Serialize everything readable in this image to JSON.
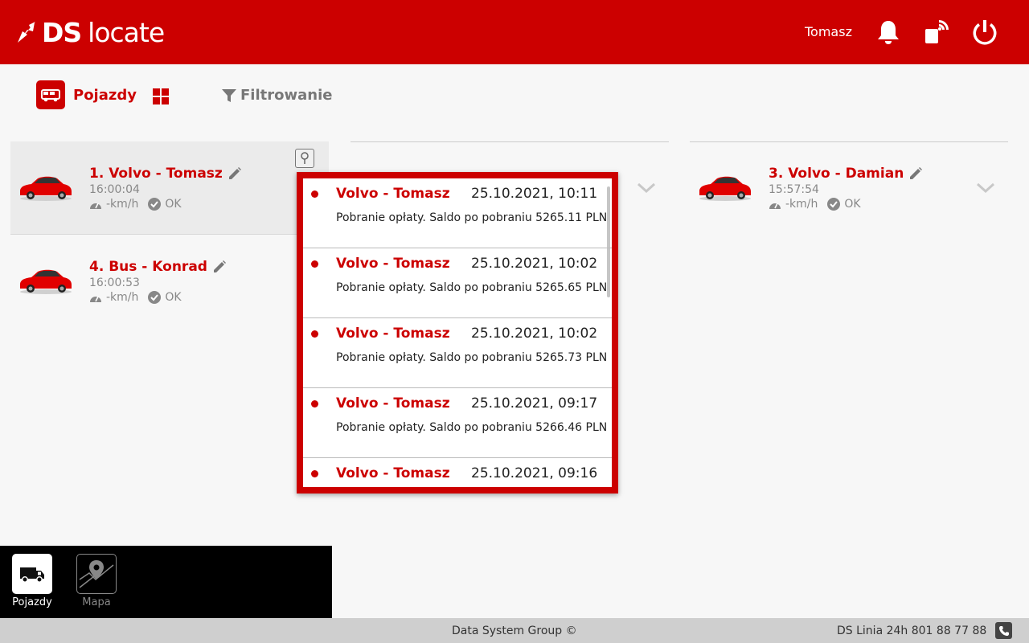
{
  "header": {
    "logo_ds": "DS",
    "logo_locate": "locate",
    "user_name": "Tomasz",
    "icons": [
      "bell-icon",
      "tag-wireless-icon",
      "power-icon"
    ]
  },
  "toolbar": {
    "vehicles_label": "Pojazdy",
    "filter_label": "Filtrowanie"
  },
  "vehicles": [
    {
      "title": "1. Volvo - Tomasz",
      "time": "16:00:04",
      "speed": "-km/h",
      "status": "OK"
    },
    {
      "title": "4. Bus - Konrad",
      "time": "16:00:53",
      "speed": "-km/h",
      "status": "OK"
    },
    {
      "title": "3. Volvo - Damian",
      "time": "15:57:54",
      "speed": "-km/h",
      "status": "OK"
    }
  ],
  "notifications": [
    {
      "vehicle": "Volvo - Tomasz",
      "date": "25.10.2021, 10:11",
      "message": "Pobranie opłaty. Saldo po pobraniu 5265.11 PLN"
    },
    {
      "vehicle": "Volvo - Tomasz",
      "date": "25.10.2021, 10:02",
      "message": "Pobranie opłaty. Saldo po pobraniu 5265.65 PLN"
    },
    {
      "vehicle": "Volvo - Tomasz",
      "date": "25.10.2021, 10:02",
      "message": "Pobranie opłaty. Saldo po pobraniu 5265.73 PLN"
    },
    {
      "vehicle": "Volvo - Tomasz",
      "date": "25.10.2021, 09:17",
      "message": "Pobranie opłaty. Saldo po pobraniu 5266.46 PLN"
    },
    {
      "vehicle": "Volvo - Tomasz",
      "date": "25.10.2021, 09:16",
      "message": ""
    }
  ],
  "bottom_nav": [
    {
      "label": "Pojazdy",
      "active": true
    },
    {
      "label": "Mapa",
      "active": false
    }
  ],
  "footer": {
    "copyright": "Data System Group ©",
    "phone": "DS Linia 24h 801 88 77 88"
  },
  "colors": {
    "brand": "#cc0000",
    "nav_bg": "#000000",
    "footer_bg": "#cfcfcf"
  }
}
